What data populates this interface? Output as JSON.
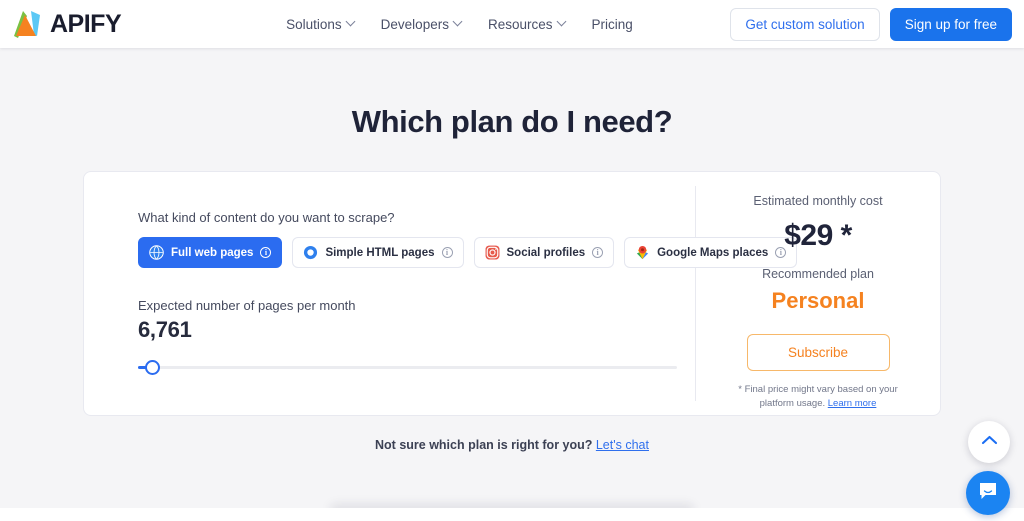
{
  "header": {
    "logo_text": "APIFY",
    "logo_icon": "apify-logo-icon",
    "nav": [
      {
        "label": "Solutions",
        "has_caret": true
      },
      {
        "label": "Developers",
        "has_caret": true
      },
      {
        "label": "Resources",
        "has_caret": true
      },
      {
        "label": "Pricing",
        "has_caret": false
      }
    ],
    "cta_secondary": "Get custom solution",
    "cta_primary": "Sign up for free"
  },
  "main": {
    "heading": "Which plan do I need?",
    "question_label": "What kind of content do you want to scrape?",
    "options": [
      {
        "label": "Full web pages",
        "icon": "globe-icon",
        "selected": true
      },
      {
        "label": "Simple HTML pages",
        "icon": "circle-dot-icon",
        "selected": false
      },
      {
        "label": "Social profiles",
        "icon": "instagram-icon",
        "selected": false
      },
      {
        "label": "Google Maps places",
        "icon": "map-pin-icon",
        "selected": false
      }
    ],
    "info_icon_char": "i",
    "slider": {
      "label": "Expected number of pages per month",
      "value": "6,761",
      "percent": 2
    }
  },
  "summary": {
    "estimate_label": "Estimated monthly cost",
    "price": "$29 *",
    "recommended_label": "Recommended plan",
    "plan_name": "Personal",
    "subscribe_label": "Subscribe",
    "fineprint_text": "* Final price might vary based on your platform usage. ",
    "fineprint_link": "Learn more"
  },
  "footer": {
    "text": "Not sure which plan is right for you? ",
    "link": "Let's chat"
  },
  "floating": {
    "scroll_top_icon": "chevron-up-icon",
    "chat_icon": "chat-bubble-icon"
  },
  "colors": {
    "blue": "#2b6cf0",
    "blue_button": "#1a73ec",
    "orange": "#f58220",
    "page_bg": "#f5f5f7",
    "heading": "#1f2338"
  }
}
